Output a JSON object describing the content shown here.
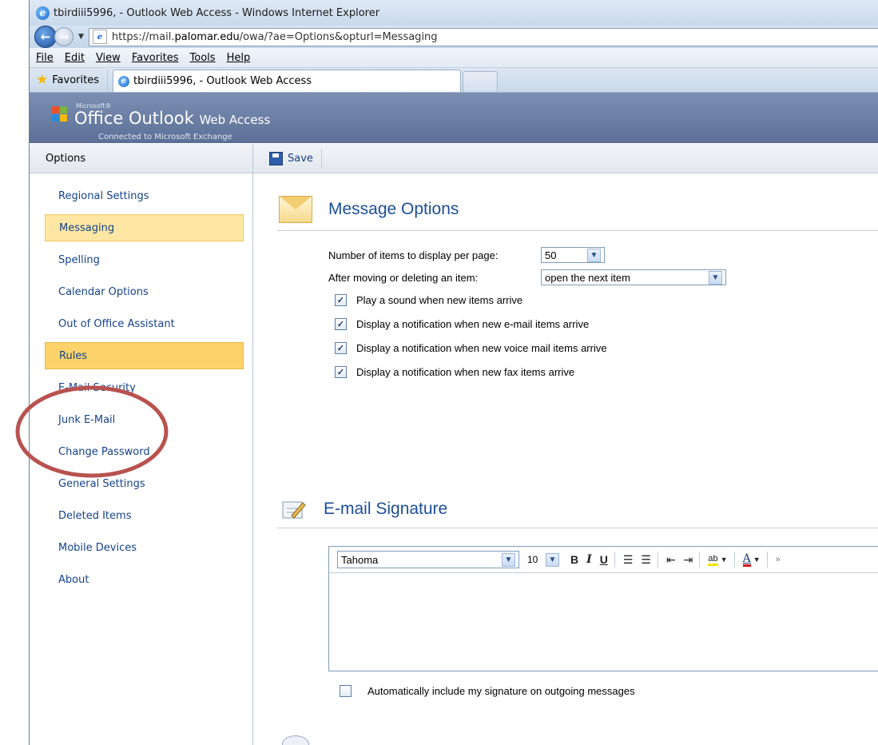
{
  "browser": {
    "window_title": "tbirdiii5996, - Outlook Web Access - Windows Internet Explorer",
    "url_prefix": "https://mail.",
    "url_domain": "palomar.edu",
    "url_suffix": "/owa/?ae=Options&opturl=Messaging",
    "menu": [
      "File",
      "Edit",
      "View",
      "Favorites",
      "Tools",
      "Help"
    ],
    "favorites_label": "Favorites",
    "tab_title": "tbirdiii5996, - Outlook Web Access"
  },
  "owa": {
    "brand_small": "Microsoft®",
    "brand_main": "Office Outlook",
    "brand_wa": "Web Access",
    "brand_sub": "Connected to Microsoft Exchange"
  },
  "nav": {
    "header": "Options",
    "items": [
      {
        "label": "Regional Settings"
      },
      {
        "label": "Messaging"
      },
      {
        "label": "Spelling"
      },
      {
        "label": "Calendar Options"
      },
      {
        "label": "Out of Office Assistant"
      },
      {
        "label": "Rules"
      },
      {
        "label": "E-Mail Security"
      },
      {
        "label": "Junk E-Mail"
      },
      {
        "label": "Change Password"
      },
      {
        "label": "General Settings"
      },
      {
        "label": "Deleted Items"
      },
      {
        "label": "Mobile Devices"
      },
      {
        "label": "About"
      }
    ],
    "selected": "Messaging",
    "highlighted": "Rules"
  },
  "toolbar": {
    "save_label": "Save"
  },
  "message_options": {
    "title": "Message Options",
    "items_per_page_label": "Number of items to display per page:",
    "items_per_page_value": "50",
    "after_move_label": "After moving or deleting an item:",
    "after_move_value": "open the next item",
    "checkboxes": [
      {
        "label": "Play a sound when new items arrive",
        "checked": true
      },
      {
        "label": "Display a notification when new e-mail items arrive",
        "checked": true
      },
      {
        "label": "Display a notification when new voice mail items arrive",
        "checked": true
      },
      {
        "label": "Display a notification when new fax items arrive",
        "checked": true
      }
    ]
  },
  "signature": {
    "title": "E-mail Signature",
    "font_value": "Tahoma",
    "size_value": "10",
    "auto_include_label": "Automatically include my signature on outgoing messages",
    "auto_include_checked": false
  },
  "colors": {
    "annotation_circle": "#b8524f",
    "link": "#15428b",
    "selected_bg": "#fde7a3",
    "header_blue": "#5c6f96"
  }
}
